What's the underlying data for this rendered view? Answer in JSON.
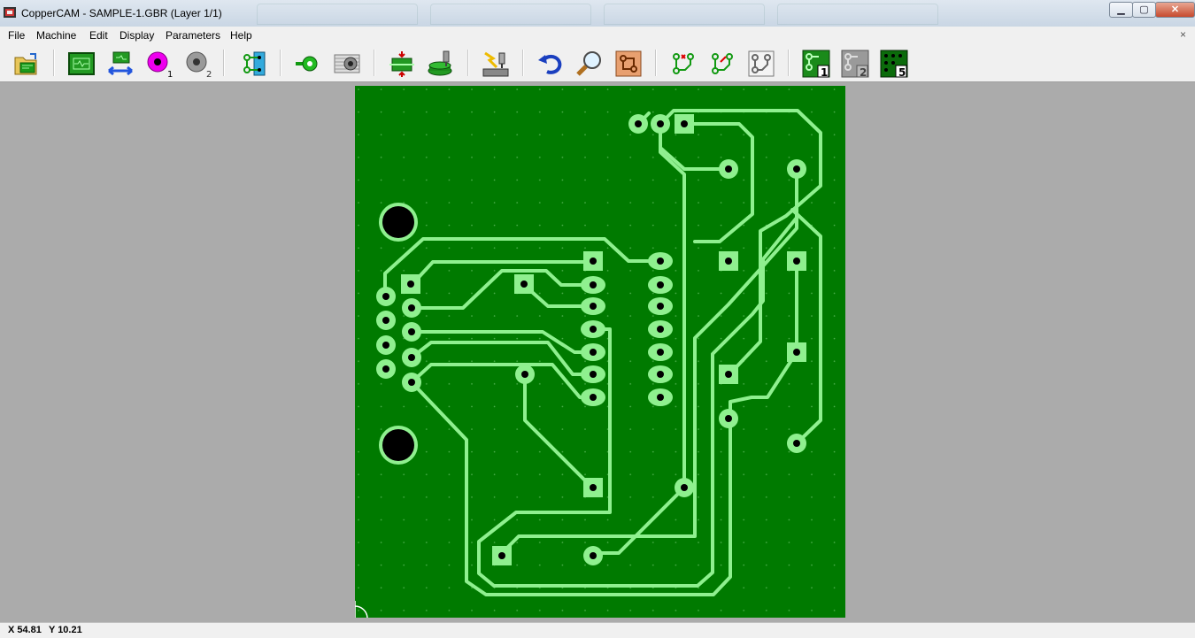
{
  "window": {
    "title": "CopperCAM  -  SAMPLE-1.GBR   (Layer 1/1)",
    "minimize_label": "▁",
    "maximize_label": "▢",
    "close_label": "✕"
  },
  "menu": {
    "items": [
      "File",
      "Machine",
      "Edit",
      "Display",
      "Parameters",
      "Help"
    ],
    "mdi_close": "×"
  },
  "toolbar": {
    "buttons": [
      {
        "name": "open-file-icon"
      },
      {
        "name": "board-view-icon"
      },
      {
        "name": "mirror-board-icon"
      },
      {
        "name": "reference-pad-1-icon",
        "badge": "1"
      },
      {
        "name": "reference-pad-2-icon",
        "badge": "2"
      },
      {
        "name": "set-contour-icon"
      },
      {
        "name": "pad-icon"
      },
      {
        "name": "hatching-icon"
      },
      {
        "name": "calculate-contours-icon"
      },
      {
        "name": "drilling-icon"
      },
      {
        "name": "mill-tool-icon"
      },
      {
        "name": "undo-icon"
      },
      {
        "name": "zoom-icon"
      },
      {
        "name": "copper-board-icon"
      },
      {
        "name": "track-contour-1-icon"
      },
      {
        "name": "track-contour-2-icon"
      },
      {
        "name": "track-contour-3-icon"
      },
      {
        "name": "layer-1-icon",
        "badge": "1"
      },
      {
        "name": "layer-2-icon",
        "badge": "2"
      },
      {
        "name": "layer-5-icon",
        "badge": "5"
      }
    ]
  },
  "colors": {
    "board": "#007a00",
    "copper": "#8ff08f",
    "hole": "#000000",
    "workspace": "#ababab"
  },
  "status": {
    "x_label": "X 54.81",
    "y_label": "Y 10.21"
  }
}
